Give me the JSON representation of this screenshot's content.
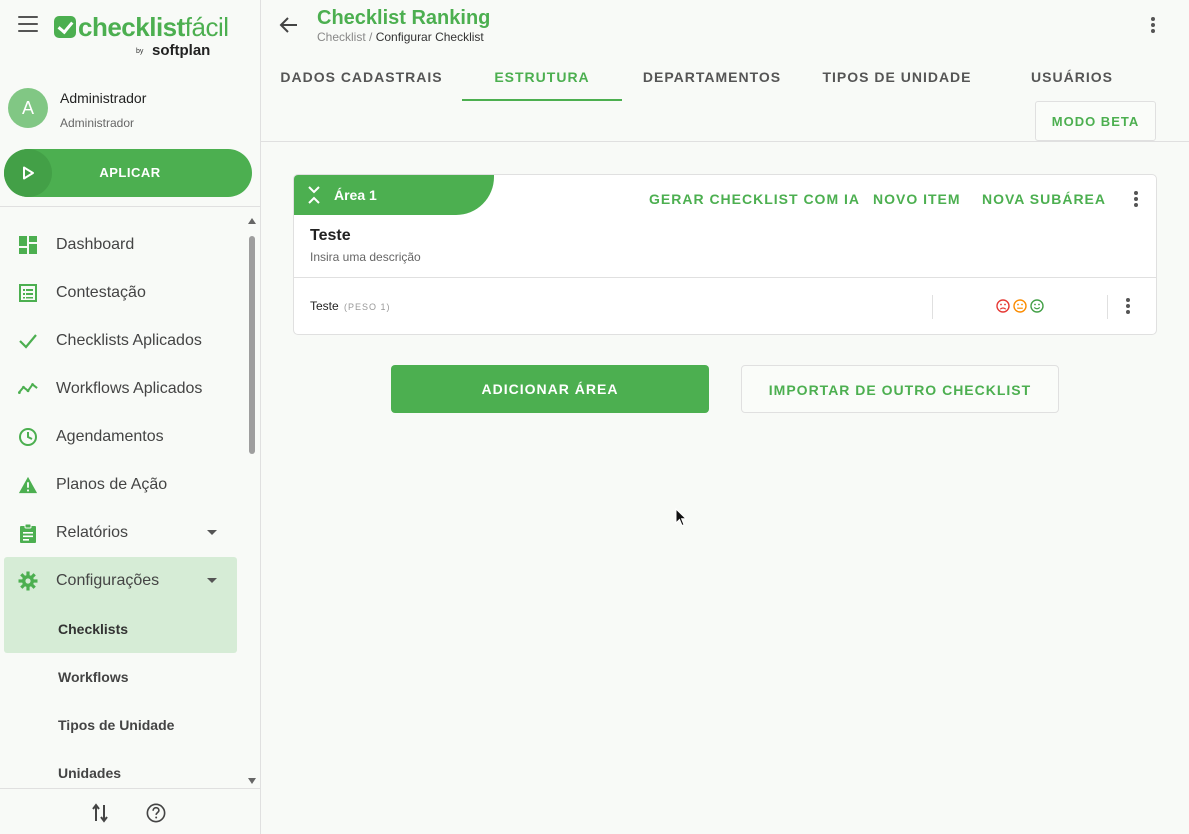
{
  "brand": {
    "name_bold": "checklist",
    "name_light": "fácil",
    "by": "by",
    "partner": "softplan",
    "accent_color": "#4caf50"
  },
  "user": {
    "initial": "A",
    "name": "Administrador",
    "role": "Administrador"
  },
  "apply_button": {
    "label": "APLICAR",
    "icon": "play-icon"
  },
  "sidebar": {
    "items": [
      {
        "label": "Dashboard",
        "icon": "dashboard-icon"
      },
      {
        "label": "Contestação",
        "icon": "list-icon"
      },
      {
        "label": "Checklists Aplicados",
        "icon": "check-icon"
      },
      {
        "label": "Workflows Aplicados",
        "icon": "trending-icon"
      },
      {
        "label": "Agendamentos",
        "icon": "clock-icon"
      },
      {
        "label": "Planos de Ação",
        "icon": "warning-icon"
      },
      {
        "label": "Relatórios",
        "icon": "clipboard-icon"
      },
      {
        "label": "Configurações",
        "icon": "gear-icon"
      }
    ],
    "sub_items": [
      {
        "label": "Checklists"
      },
      {
        "label": "Workflows"
      },
      {
        "label": "Tipos de Unidade"
      },
      {
        "label": "Unidades"
      }
    ],
    "footer_icons": [
      "swap-icon",
      "help-icon"
    ]
  },
  "header": {
    "title": "Checklist Ranking",
    "breadcrumb_parent": "Checklist",
    "breadcrumb_separator": " / ",
    "breadcrumb_current": "Configurar Checklist"
  },
  "tabs": [
    {
      "label": "DADOS CADASTRAIS"
    },
    {
      "label": "ESTRUTURA"
    },
    {
      "label": "DEPARTAMENTOS"
    },
    {
      "label": "TIPOS DE UNIDADE"
    },
    {
      "label": "USUÁRIOS"
    }
  ],
  "beta_button": {
    "label": "MODO BETA"
  },
  "area": {
    "label": "Área 1",
    "name": "Teste",
    "description": "Insira uma descrição",
    "actions": {
      "generate_ai": "GERAR CHECKLIST COM IA",
      "new_item": "NOVO ITEM",
      "new_subarea": "NOVA SUBÁREA"
    },
    "items": [
      {
        "name": "Teste",
        "weight": "(PESO 1)",
        "evaluation_colors": [
          "#e53935",
          "#fb8c00",
          "#43a047"
        ]
      }
    ]
  },
  "buttons": {
    "add_area": "ADICIONAR ÁREA",
    "import": "IMPORTAR DE OUTRO CHECKLIST"
  }
}
